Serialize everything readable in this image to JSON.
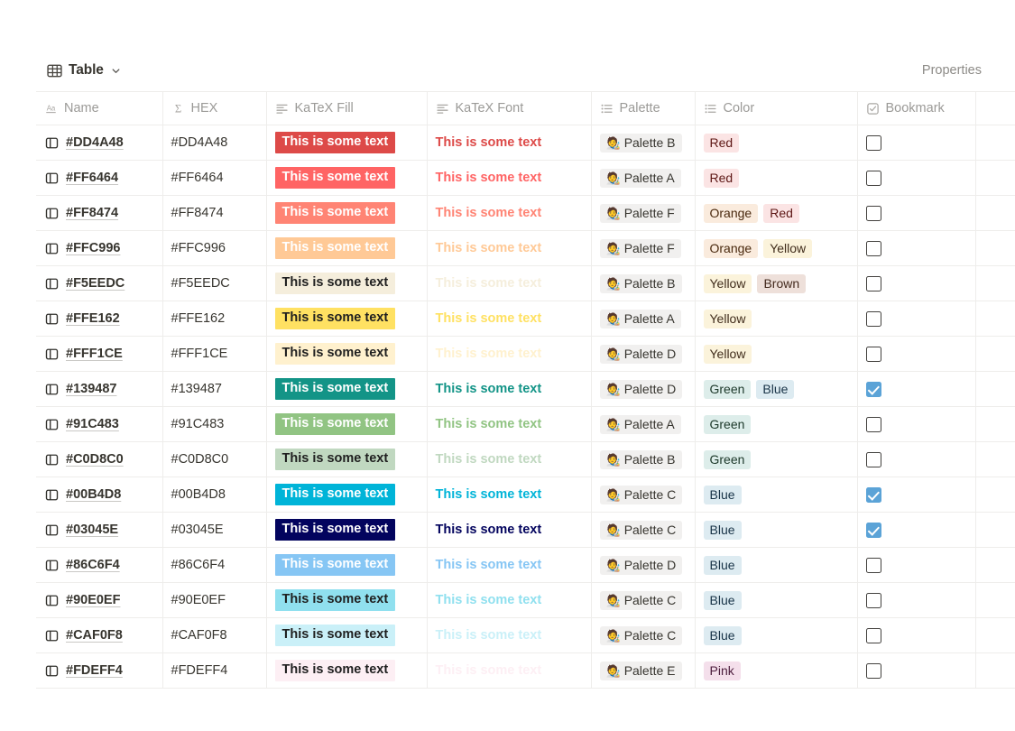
{
  "view": {
    "icon": "table-grid-icon",
    "label": "Table",
    "chevron": "chevron-down-icon",
    "properties_label": "Properties"
  },
  "table": {
    "columns": [
      {
        "label": "Name",
        "icon": "text-aa-icon",
        "type": "title"
      },
      {
        "label": "HEX",
        "icon": "formula-sigma-icon",
        "type": "formula"
      },
      {
        "label": "KaTeX Fill",
        "icon": "rich-text-icon",
        "type": "text"
      },
      {
        "label": "KaTeX Font",
        "icon": "rich-text-icon",
        "type": "text"
      },
      {
        "label": "Palette",
        "icon": "multi-select-icon",
        "type": "select"
      },
      {
        "label": "Color",
        "icon": "multi-select-icon",
        "type": "multi-select"
      },
      {
        "label": "Bookmark",
        "icon": "checkbox-icon",
        "type": "checkbox"
      },
      {
        "label": "",
        "icon": "",
        "type": "partial"
      }
    ],
    "sample_text": "This is some text",
    "rows": [
      {
        "name": "#DD4A48",
        "hex": "#DD4A48",
        "fill_bg": "#DD4A48",
        "fill_fg": "#FFFFFF",
        "font_color": "#DD4A48",
        "palette": "Palette B",
        "colors": [
          "Red"
        ],
        "bookmark": false
      },
      {
        "name": "#FF6464",
        "hex": "#FF6464",
        "fill_bg": "#FF6464",
        "fill_fg": "#FFFFFF",
        "font_color": "#FF6464",
        "palette": "Palette A",
        "colors": [
          "Red"
        ],
        "bookmark": false
      },
      {
        "name": "#FF8474",
        "hex": "#FF8474",
        "fill_bg": "#FF8474",
        "fill_fg": "#FFFFFF",
        "font_color": "#FF8474",
        "palette": "Palette F",
        "colors": [
          "Orange",
          "Red"
        ],
        "bookmark": false
      },
      {
        "name": "#FFC996",
        "hex": "#FFC996",
        "fill_bg": "#FFC996",
        "fill_fg": "#FFFFFF",
        "font_color": "#FFC996",
        "palette": "Palette F",
        "colors": [
          "Orange",
          "Yellow"
        ],
        "bookmark": false
      },
      {
        "name": "#F5EEDC",
        "hex": "#F5EEDC",
        "fill_bg": "#F5EEDC",
        "fill_fg": "#1F1F1F",
        "font_color": "#F5EEDC",
        "palette": "Palette B",
        "colors": [
          "Yellow",
          "Brown"
        ],
        "bookmark": false
      },
      {
        "name": "#FFE162",
        "hex": "#FFE162",
        "fill_bg": "#FFE162",
        "fill_fg": "#1F1F1F",
        "font_color": "#FFE162",
        "palette": "Palette A",
        "colors": [
          "Yellow"
        ],
        "bookmark": false
      },
      {
        "name": "#FFF1CE",
        "hex": "#FFF1CE",
        "fill_bg": "#FFF1CE",
        "fill_fg": "#1F1F1F",
        "font_color": "#FFF1CE",
        "palette": "Palette D",
        "colors": [
          "Yellow"
        ],
        "bookmark": false
      },
      {
        "name": "#139487",
        "hex": "#139487",
        "fill_bg": "#139487",
        "fill_fg": "#FFFFFF",
        "font_color": "#139487",
        "palette": "Palette D",
        "colors": [
          "Green",
          "Blue"
        ],
        "bookmark": true
      },
      {
        "name": "#91C483",
        "hex": "#91C483",
        "fill_bg": "#91C483",
        "fill_fg": "#FFFFFF",
        "font_color": "#91C483",
        "palette": "Palette A",
        "colors": [
          "Green"
        ],
        "bookmark": false
      },
      {
        "name": "#C0D8C0",
        "hex": "#C0D8C0",
        "fill_bg": "#C0D8C0",
        "fill_fg": "#1F1F1F",
        "font_color": "#C0D8C0",
        "palette": "Palette B",
        "colors": [
          "Green"
        ],
        "bookmark": false
      },
      {
        "name": "#00B4D8",
        "hex": "#00B4D8",
        "fill_bg": "#00B4D8",
        "fill_fg": "#FFFFFF",
        "font_color": "#00B4D8",
        "palette": "Palette C",
        "colors": [
          "Blue"
        ],
        "bookmark": true
      },
      {
        "name": "#03045E",
        "hex": "#03045E",
        "fill_bg": "#03045E",
        "fill_fg": "#FFFFFF",
        "font_color": "#03045E",
        "palette": "Palette C",
        "colors": [
          "Blue"
        ],
        "bookmark": true
      },
      {
        "name": "#86C6F4",
        "hex": "#86C6F4",
        "fill_bg": "#86C6F4",
        "fill_fg": "#FFFFFF",
        "font_color": "#86C6F4",
        "palette": "Palette D",
        "colors": [
          "Blue"
        ],
        "bookmark": false
      },
      {
        "name": "#90E0EF",
        "hex": "#90E0EF",
        "fill_bg": "#90E0EF",
        "fill_fg": "#1F1F1F",
        "font_color": "#90E0EF",
        "palette": "Palette C",
        "colors": [
          "Blue"
        ],
        "bookmark": false
      },
      {
        "name": "#CAF0F8",
        "hex": "#CAF0F8",
        "fill_bg": "#CAF0F8",
        "fill_fg": "#1F1F1F",
        "font_color": "#CAF0F8",
        "palette": "Palette C",
        "colors": [
          "Blue"
        ],
        "bookmark": false
      },
      {
        "name": "#FDEFF4",
        "hex": "#FDEFF4",
        "fill_bg": "#FDEFF4",
        "fill_fg": "#1F1F1F",
        "font_color": "#FDEFF4",
        "palette": "Palette E",
        "colors": [
          "Pink"
        ],
        "bookmark": false
      }
    ]
  },
  "tag_styles": {
    "Red": {
      "bg": "#FBE4E4",
      "fg": "#5D1715"
    },
    "Orange": {
      "bg": "#FAEBDD",
      "fg": "#49290E"
    },
    "Yellow": {
      "bg": "#FBF3DB",
      "fg": "#402C1B"
    },
    "Brown": {
      "bg": "#EEE0DA",
      "fg": "#442A1E"
    },
    "Green": {
      "bg": "#DDEDEA",
      "fg": "#1C3829"
    },
    "Blue": {
      "bg": "#DDEBF1",
      "fg": "#183347"
    },
    "Pink": {
      "bg": "#F4DFEB",
      "fg": "#4C1D3D"
    },
    "Palette": {
      "bg": "#F1F0EF",
      "fg": "#37352F"
    }
  },
  "icons": {
    "palette_emoji": "🧑‍🎨"
  }
}
